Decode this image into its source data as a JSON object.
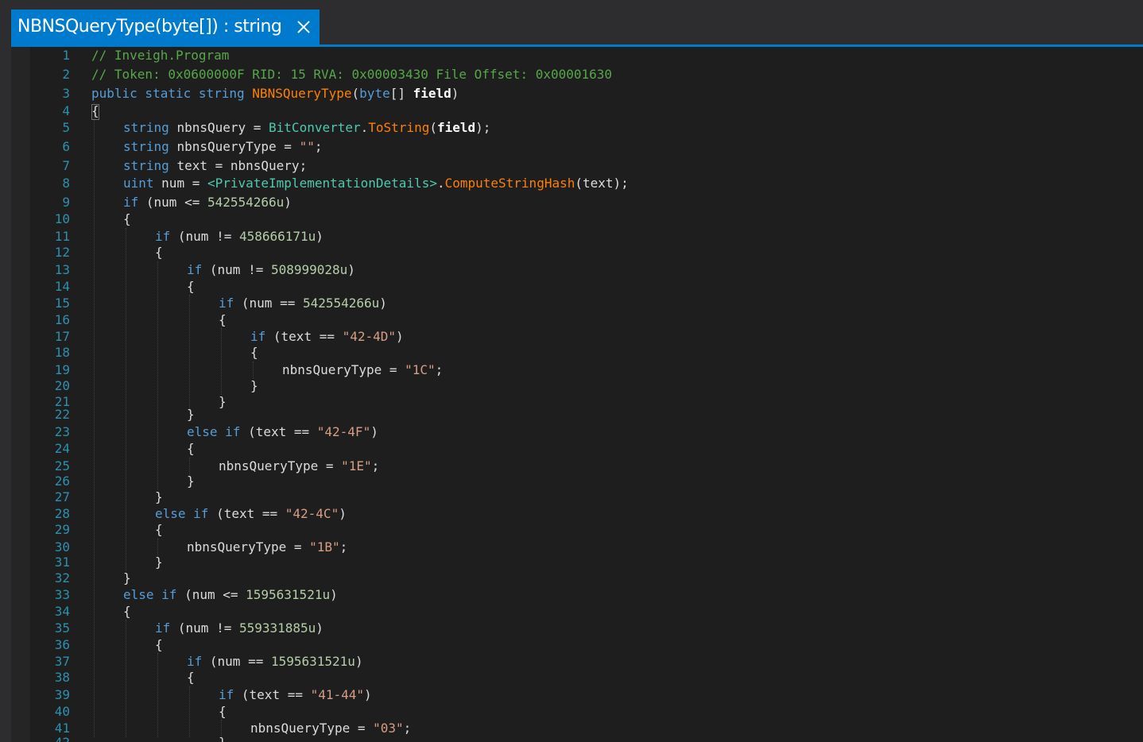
{
  "tab": {
    "title": "NBNSQueryType(byte[]) : string",
    "close_icon": "close-icon"
  },
  "colors": {
    "accent": "#007acc",
    "editor_bg": "#1e1e1e",
    "line_number": "#2b91af",
    "keyword": "#569cd6",
    "comment": "#57a64a",
    "string": "#d69d85",
    "number": "#b5cea8",
    "type": "#4ec9b0",
    "method": "#ff8000",
    "plain": "#dcdcdc"
  },
  "lines": [
    {
      "n": "1",
      "indent": 0,
      "tokens": [
        [
          "cm",
          "// Inveigh.Program"
        ]
      ]
    },
    {
      "n": "2",
      "indent": 0,
      "tokens": [
        [
          "cm",
          "// Token: 0x0600000F RID: 15 RVA: 0x00003430 File Offset: 0x00001630"
        ]
      ]
    },
    {
      "n": "3",
      "indent": 0,
      "tokens": [
        [
          "kw",
          "public static string "
        ],
        [
          "mth",
          "NBNSQueryType"
        ],
        [
          "pl",
          "("
        ],
        [
          "kw",
          "byte"
        ],
        [
          "pl",
          "[] "
        ],
        [
          "prm",
          "field"
        ],
        [
          "pl",
          ")"
        ]
      ]
    },
    {
      "n": "4",
      "indent": 0,
      "tokens": [
        [
          "pl",
          "{"
        ]
      ]
    },
    {
      "n": "5",
      "indent": 1,
      "tokens": [
        [
          "kw",
          "string "
        ],
        [
          "pl",
          "nbnsQuery = "
        ],
        [
          "cls",
          "BitConverter"
        ],
        [
          "pl",
          "."
        ],
        [
          "mth",
          "ToString"
        ],
        [
          "pl",
          "("
        ],
        [
          "prm",
          "field"
        ],
        [
          "pl",
          ");"
        ]
      ]
    },
    {
      "n": "6",
      "indent": 1,
      "tokens": [
        [
          "kw",
          "string "
        ],
        [
          "pl",
          "nbnsQueryType = "
        ],
        [
          "str",
          "\"\""
        ],
        [
          "pl",
          ";"
        ]
      ]
    },
    {
      "n": "7",
      "indent": 1,
      "tokens": [
        [
          "kw",
          "string "
        ],
        [
          "pl",
          "text = nbnsQuery;"
        ]
      ]
    },
    {
      "n": "8",
      "indent": 1,
      "tokens": [
        [
          "kw",
          "uint "
        ],
        [
          "pl",
          "num = "
        ],
        [
          "cls",
          "<PrivateImplementationDetails>"
        ],
        [
          "pl",
          "."
        ],
        [
          "mth",
          "ComputeStringHash"
        ],
        [
          "pl",
          "(text);"
        ]
      ]
    },
    {
      "n": "9",
      "indent": 1,
      "tokens": [
        [
          "kw",
          "if "
        ],
        [
          "pl",
          "(num <= "
        ],
        [
          "num",
          "542554266u"
        ],
        [
          "pl",
          ")"
        ]
      ]
    },
    {
      "n": "10",
      "indent": 1,
      "tokens": [
        [
          "pl",
          "{"
        ]
      ]
    },
    {
      "n": "11",
      "indent": 2,
      "tokens": [
        [
          "kw",
          "if "
        ],
        [
          "pl",
          "(num != "
        ],
        [
          "num",
          "458666171u"
        ],
        [
          "pl",
          ")"
        ]
      ]
    },
    {
      "n": "12",
      "indent": 2,
      "tokens": [
        [
          "pl",
          "{"
        ]
      ]
    },
    {
      "n": "13",
      "indent": 3,
      "tokens": [
        [
          "kw",
          "if "
        ],
        [
          "pl",
          "(num != "
        ],
        [
          "num",
          "508999028u"
        ],
        [
          "pl",
          ")"
        ]
      ]
    },
    {
      "n": "14",
      "indent": 3,
      "tokens": [
        [
          "pl",
          "{"
        ]
      ]
    },
    {
      "n": "15",
      "indent": 4,
      "tokens": [
        [
          "kw",
          "if "
        ],
        [
          "pl",
          "(num == "
        ],
        [
          "num",
          "542554266u"
        ],
        [
          "pl",
          ")"
        ]
      ]
    },
    {
      "n": "16",
      "indent": 4,
      "tokens": [
        [
          "pl",
          "{"
        ]
      ]
    },
    {
      "n": "17",
      "indent": 5,
      "tokens": [
        [
          "kw",
          "if "
        ],
        [
          "pl",
          "(text == "
        ],
        [
          "str",
          "\"42-4D\""
        ],
        [
          "pl",
          ")"
        ]
      ]
    },
    {
      "n": "18",
      "indent": 5,
      "tokens": [
        [
          "pl",
          "{"
        ]
      ]
    },
    {
      "n": "19",
      "indent": 6,
      "tokens": [
        [
          "pl",
          "nbnsQueryType = "
        ],
        [
          "str",
          "\"1C\""
        ],
        [
          "pl",
          ";"
        ]
      ]
    },
    {
      "n": "20",
      "indent": 5,
      "tokens": [
        [
          "pl",
          "}"
        ]
      ]
    },
    {
      "n": "21",
      "indent": 4,
      "tokens": [
        [
          "pl",
          "}"
        ]
      ]
    },
    {
      "n": "22",
      "indent": 3,
      "tokens": [
        [
          "pl",
          "}"
        ]
      ]
    },
    {
      "n": "23",
      "indent": 3,
      "tokens": [
        [
          "kw",
          "else if "
        ],
        [
          "pl",
          "(text == "
        ],
        [
          "str",
          "\"42-4F\""
        ],
        [
          "pl",
          ")"
        ]
      ]
    },
    {
      "n": "24",
      "indent": 3,
      "tokens": [
        [
          "pl",
          "{"
        ]
      ]
    },
    {
      "n": "25",
      "indent": 4,
      "tokens": [
        [
          "pl",
          "nbnsQueryType = "
        ],
        [
          "str",
          "\"1E\""
        ],
        [
          "pl",
          ";"
        ]
      ]
    },
    {
      "n": "26",
      "indent": 3,
      "tokens": [
        [
          "pl",
          "}"
        ]
      ]
    },
    {
      "n": "27",
      "indent": 2,
      "tokens": [
        [
          "pl",
          "}"
        ]
      ]
    },
    {
      "n": "28",
      "indent": 2,
      "tokens": [
        [
          "kw",
          "else if "
        ],
        [
          "pl",
          "(text == "
        ],
        [
          "str",
          "\"42-4C\""
        ],
        [
          "pl",
          ")"
        ]
      ]
    },
    {
      "n": "29",
      "indent": 2,
      "tokens": [
        [
          "pl",
          "{"
        ]
      ]
    },
    {
      "n": "30",
      "indent": 3,
      "tokens": [
        [
          "pl",
          "nbnsQueryType = "
        ],
        [
          "str",
          "\"1B\""
        ],
        [
          "pl",
          ";"
        ]
      ]
    },
    {
      "n": "31",
      "indent": 2,
      "tokens": [
        [
          "pl",
          "}"
        ]
      ]
    },
    {
      "n": "32",
      "indent": 1,
      "tokens": [
        [
          "pl",
          "}"
        ]
      ]
    },
    {
      "n": "33",
      "indent": 1,
      "tokens": [
        [
          "kw",
          "else if "
        ],
        [
          "pl",
          "(num <= "
        ],
        [
          "num",
          "1595631521u"
        ],
        [
          "pl",
          ")"
        ]
      ]
    },
    {
      "n": "34",
      "indent": 1,
      "tokens": [
        [
          "pl",
          "{"
        ]
      ]
    },
    {
      "n": "35",
      "indent": 2,
      "tokens": [
        [
          "kw",
          "if "
        ],
        [
          "pl",
          "(num != "
        ],
        [
          "num",
          "559331885u"
        ],
        [
          "pl",
          ")"
        ]
      ]
    },
    {
      "n": "36",
      "indent": 2,
      "tokens": [
        [
          "pl",
          "{"
        ]
      ]
    },
    {
      "n": "37",
      "indent": 3,
      "tokens": [
        [
          "kw",
          "if "
        ],
        [
          "pl",
          "(num == "
        ],
        [
          "num",
          "1595631521u"
        ],
        [
          "pl",
          ")"
        ]
      ]
    },
    {
      "n": "38",
      "indent": 3,
      "tokens": [
        [
          "pl",
          "{"
        ]
      ]
    },
    {
      "n": "39",
      "indent": 4,
      "tokens": [
        [
          "kw",
          "if "
        ],
        [
          "pl",
          "(text == "
        ],
        [
          "str",
          "\"41-44\""
        ],
        [
          "pl",
          ")"
        ]
      ]
    },
    {
      "n": "40",
      "indent": 4,
      "tokens": [
        [
          "pl",
          "{"
        ]
      ]
    },
    {
      "n": "41",
      "indent": 5,
      "tokens": [
        [
          "pl",
          "nbnsQueryType = "
        ],
        [
          "str",
          "\"03\""
        ],
        [
          "pl",
          ";"
        ]
      ]
    },
    {
      "n": "42",
      "indent": 4,
      "tokens": [
        [
          "pl",
          "}"
        ]
      ]
    }
  ]
}
